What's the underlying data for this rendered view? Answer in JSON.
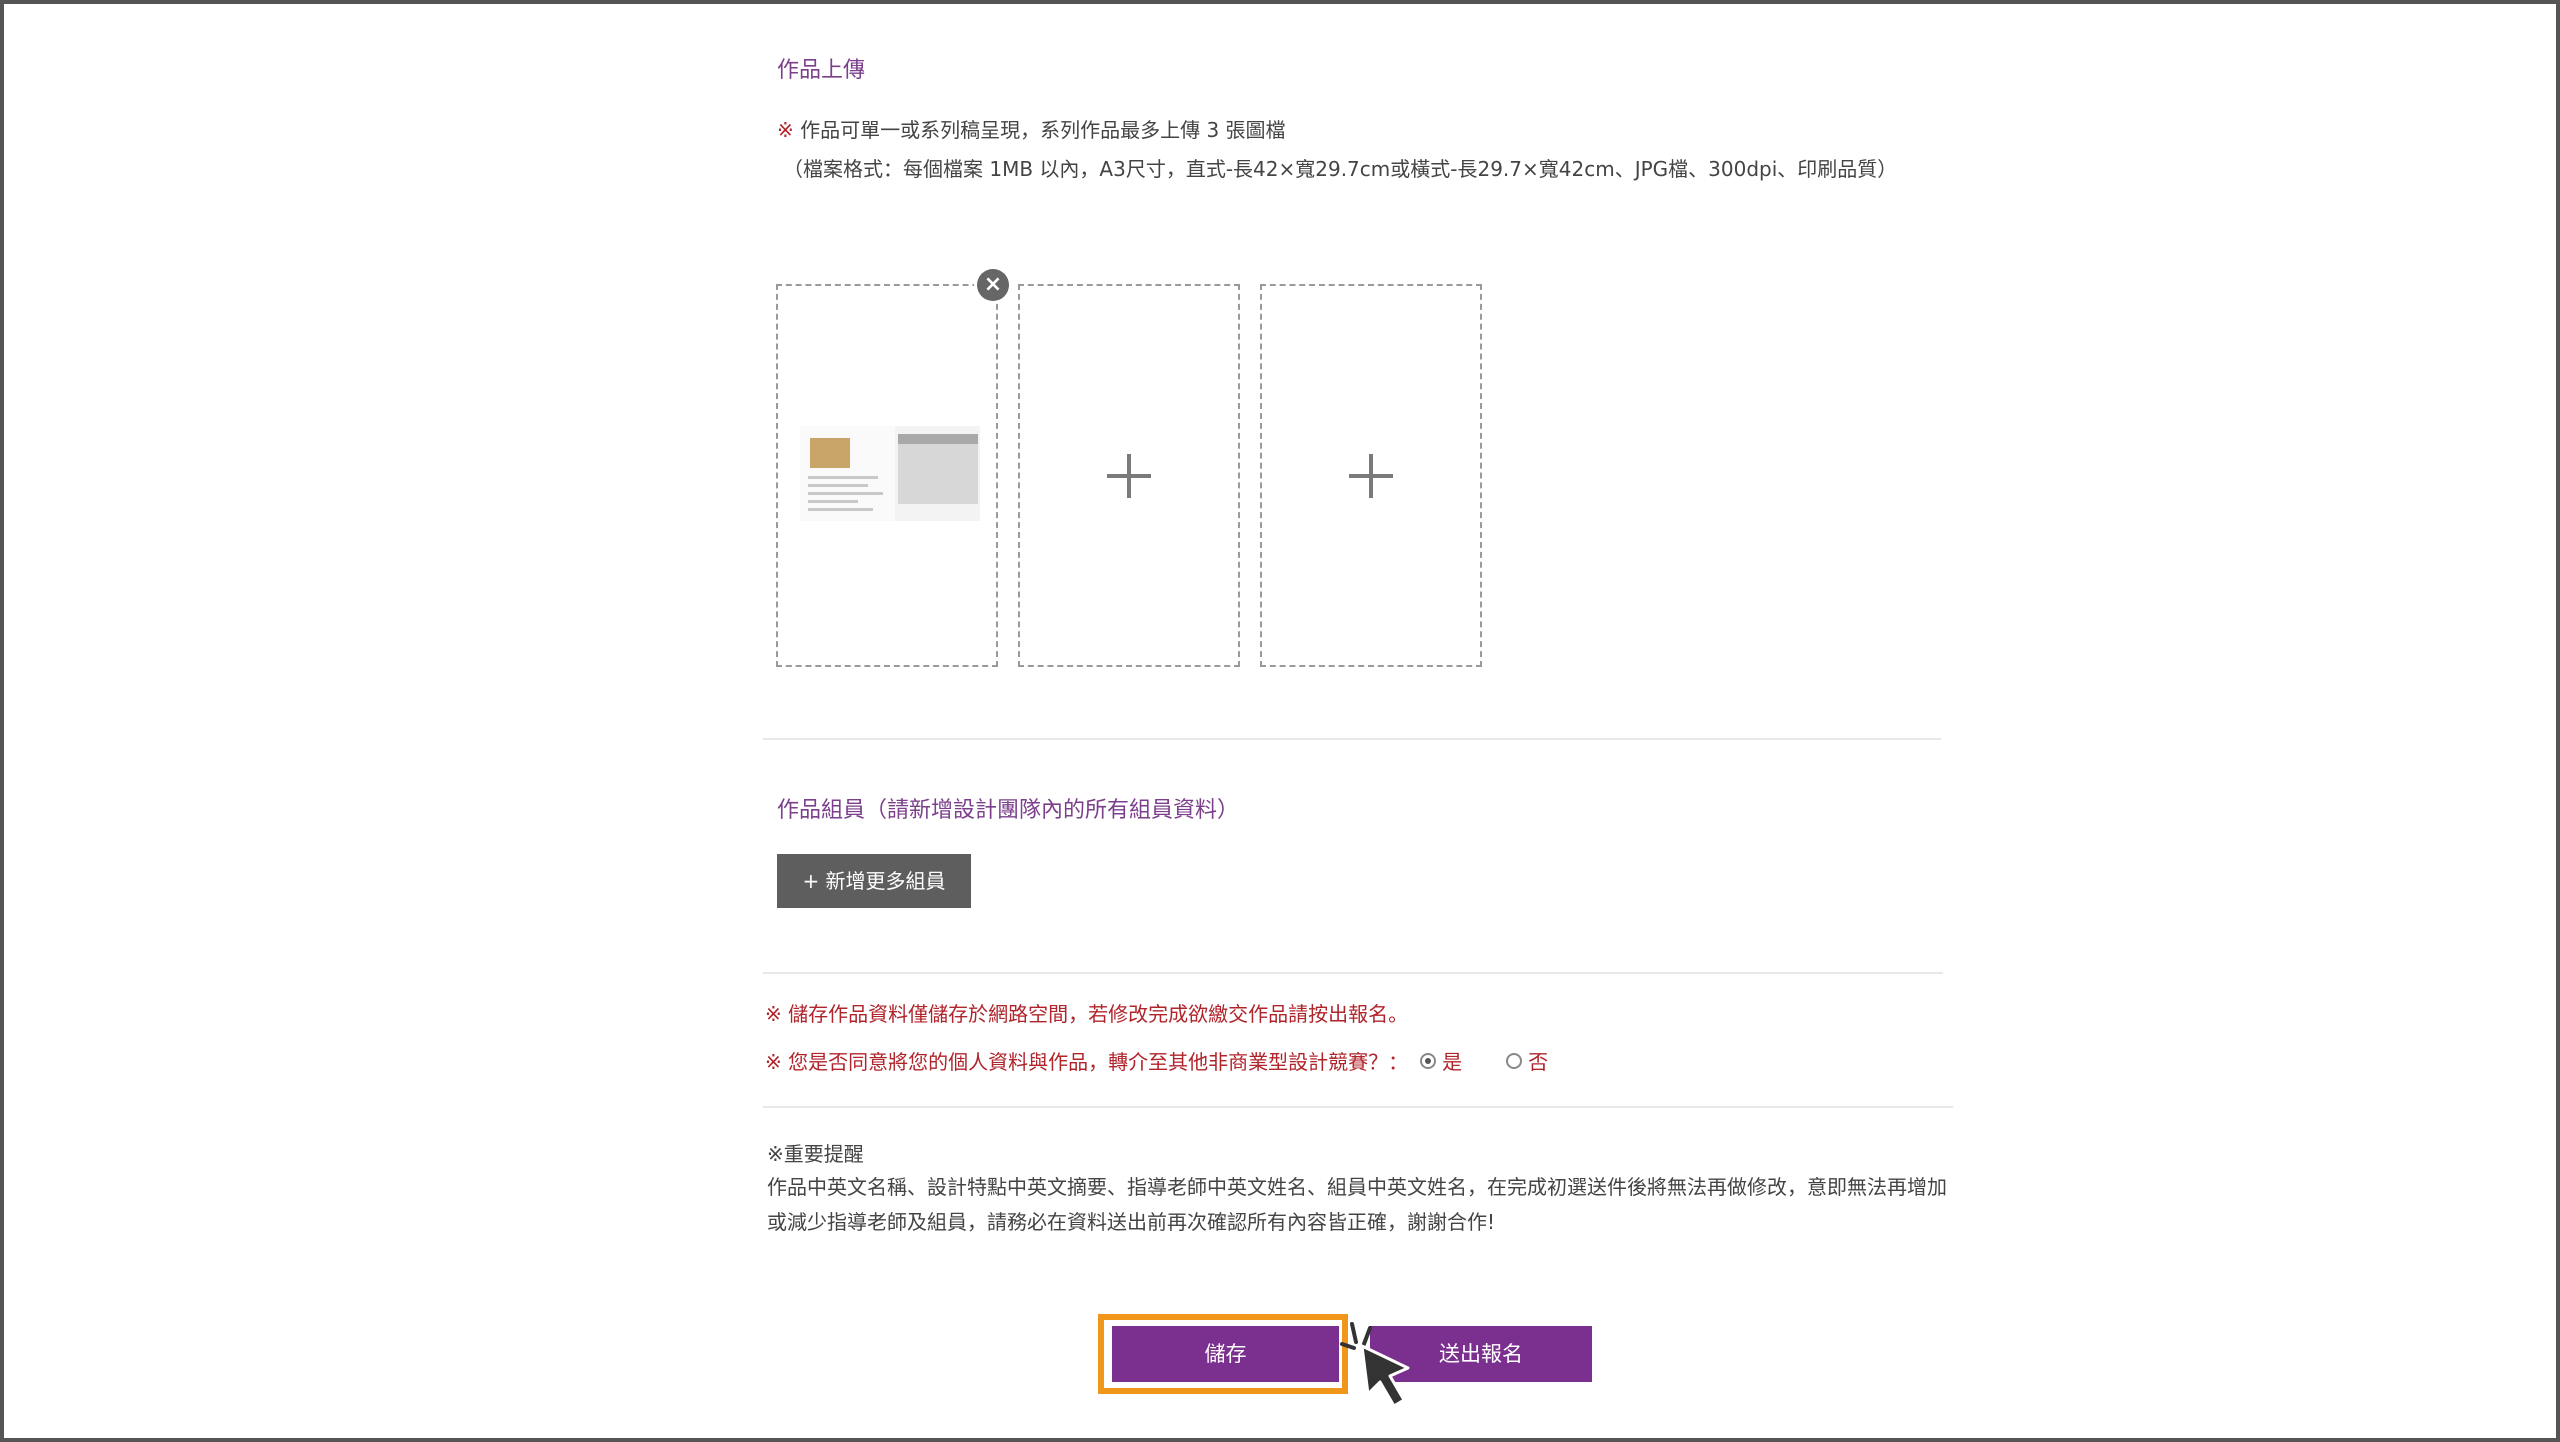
{
  "upload": {
    "title": "作品上傳",
    "note_mark": "※",
    "note_text": " 作品可單一或系列稿呈現，系列作品最多上傳 3 張圖檔",
    "format_note": "（檔案格式：每個檔案 1MB 以內，A3尺寸，直式-長42×寬29.7cm或橫式-長29.7×寬42cm、JPG檔、300dpi、印刷品質）",
    "remove_label": "×"
  },
  "members": {
    "title": "作品組員（請新增設計團隊內的所有組員資料）",
    "add_button": "+ 新增更多組員"
  },
  "warnings": {
    "save_notice": "※ 儲存作品資料僅儲存於網路空間，若修改完成欲繳交作品請按出報名。",
    "consent_question": "※ 您是否同意將您的個人資料與作品，轉介至其他非商業型設計競賽？：",
    "option_yes": "是",
    "option_no": "否",
    "selected": "是"
  },
  "important": {
    "title": "※重要提醒",
    "body": "作品中英文名稱、設計特點中英文摘要、指導老師中英文姓名、組員中英文姓名，在完成初選送件後將無法再做修改，意即無法再增加或減少指導老師及組員，請務必在資料送出前再次確認所有內容皆正確，謝謝合作!"
  },
  "actions": {
    "save": "儲存",
    "submit": "送出報名"
  },
  "colors": {
    "accent": "#7b2f8e",
    "warning": "#b0242b",
    "highlight": "#f0961a"
  }
}
